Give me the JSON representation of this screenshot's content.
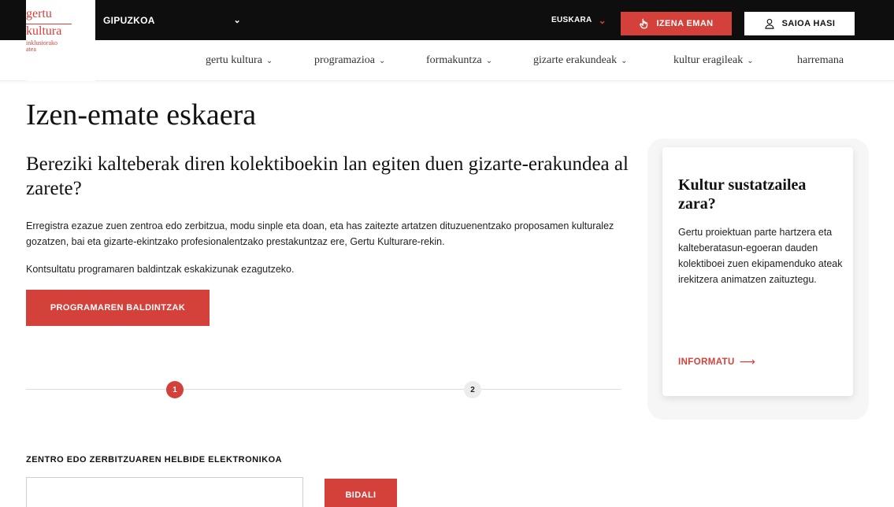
{
  "logo": {
    "line1": "gertu",
    "line2": "kultura",
    "sub1": "inklusiorako",
    "sub2": "atea"
  },
  "topbar": {
    "region": "GIPUZKOA",
    "language": "EUSKARA",
    "register_label": "IZENA EMAN",
    "login_label": "SAIOA HASI"
  },
  "nav": {
    "items": [
      {
        "label": "gertu kultura",
        "has_dropdown": true
      },
      {
        "label": "programazioa",
        "has_dropdown": true
      },
      {
        "label": "formakuntza",
        "has_dropdown": true
      },
      {
        "label": "gizarte erakundeak",
        "has_dropdown": true
      },
      {
        "label": "kultur eragileak",
        "has_dropdown": true
      },
      {
        "label": "harremana",
        "has_dropdown": false
      }
    ]
  },
  "main": {
    "title": "Izen-emate eskaera",
    "subtitle": "Bereziki kalteberak diren kolektiboekin lan egiten duen gizarte-erakundea al zarete?",
    "paragraph1": "Erregistra ezazue zuen zentroa edo zerbitzua, modu sinple eta doan, eta has zaitezte artatzen dituzuenentzako proposamen kulturalez gozatzen, bai eta gizarte-ekintzako profesionalentzako prestakuntzaz ere, Gertu Kulturare-rekin.",
    "paragraph2": "Kontsultatu programaren baldintzak eskakizunak ezagutzeko.",
    "conditions_button": "PROGRAMAREN BALDINTZAK"
  },
  "steps": {
    "current": 1,
    "items": [
      "1",
      "2"
    ]
  },
  "form": {
    "email_label": "ZENTRO EDO ZERBITZUAREN HELBIDE ELEKTRONIKOA",
    "email_value": "",
    "email_placeholder": "",
    "submit_label": "BIDALI"
  },
  "side_card": {
    "title": "Kultur sustatzailea zara?",
    "text": "Gertu proiektuan parte hartzera eta kalteberatasun-egoeran dauden kolektiboei zuen ekipamenduko ateak irekitzera animatzen zaituztegu.",
    "link_label": "INFORMATU"
  },
  "colors": {
    "accent": "#d4403a",
    "topbar_bg": "#0e0e0e",
    "step_inactive": "#ececec"
  },
  "icons": {
    "region_dropdown": "chevron-down-icon",
    "language_dropdown": "chevron-down-icon",
    "register": "hand-pointer-icon",
    "login": "user-icon",
    "card_link": "arrow-right-icon"
  }
}
